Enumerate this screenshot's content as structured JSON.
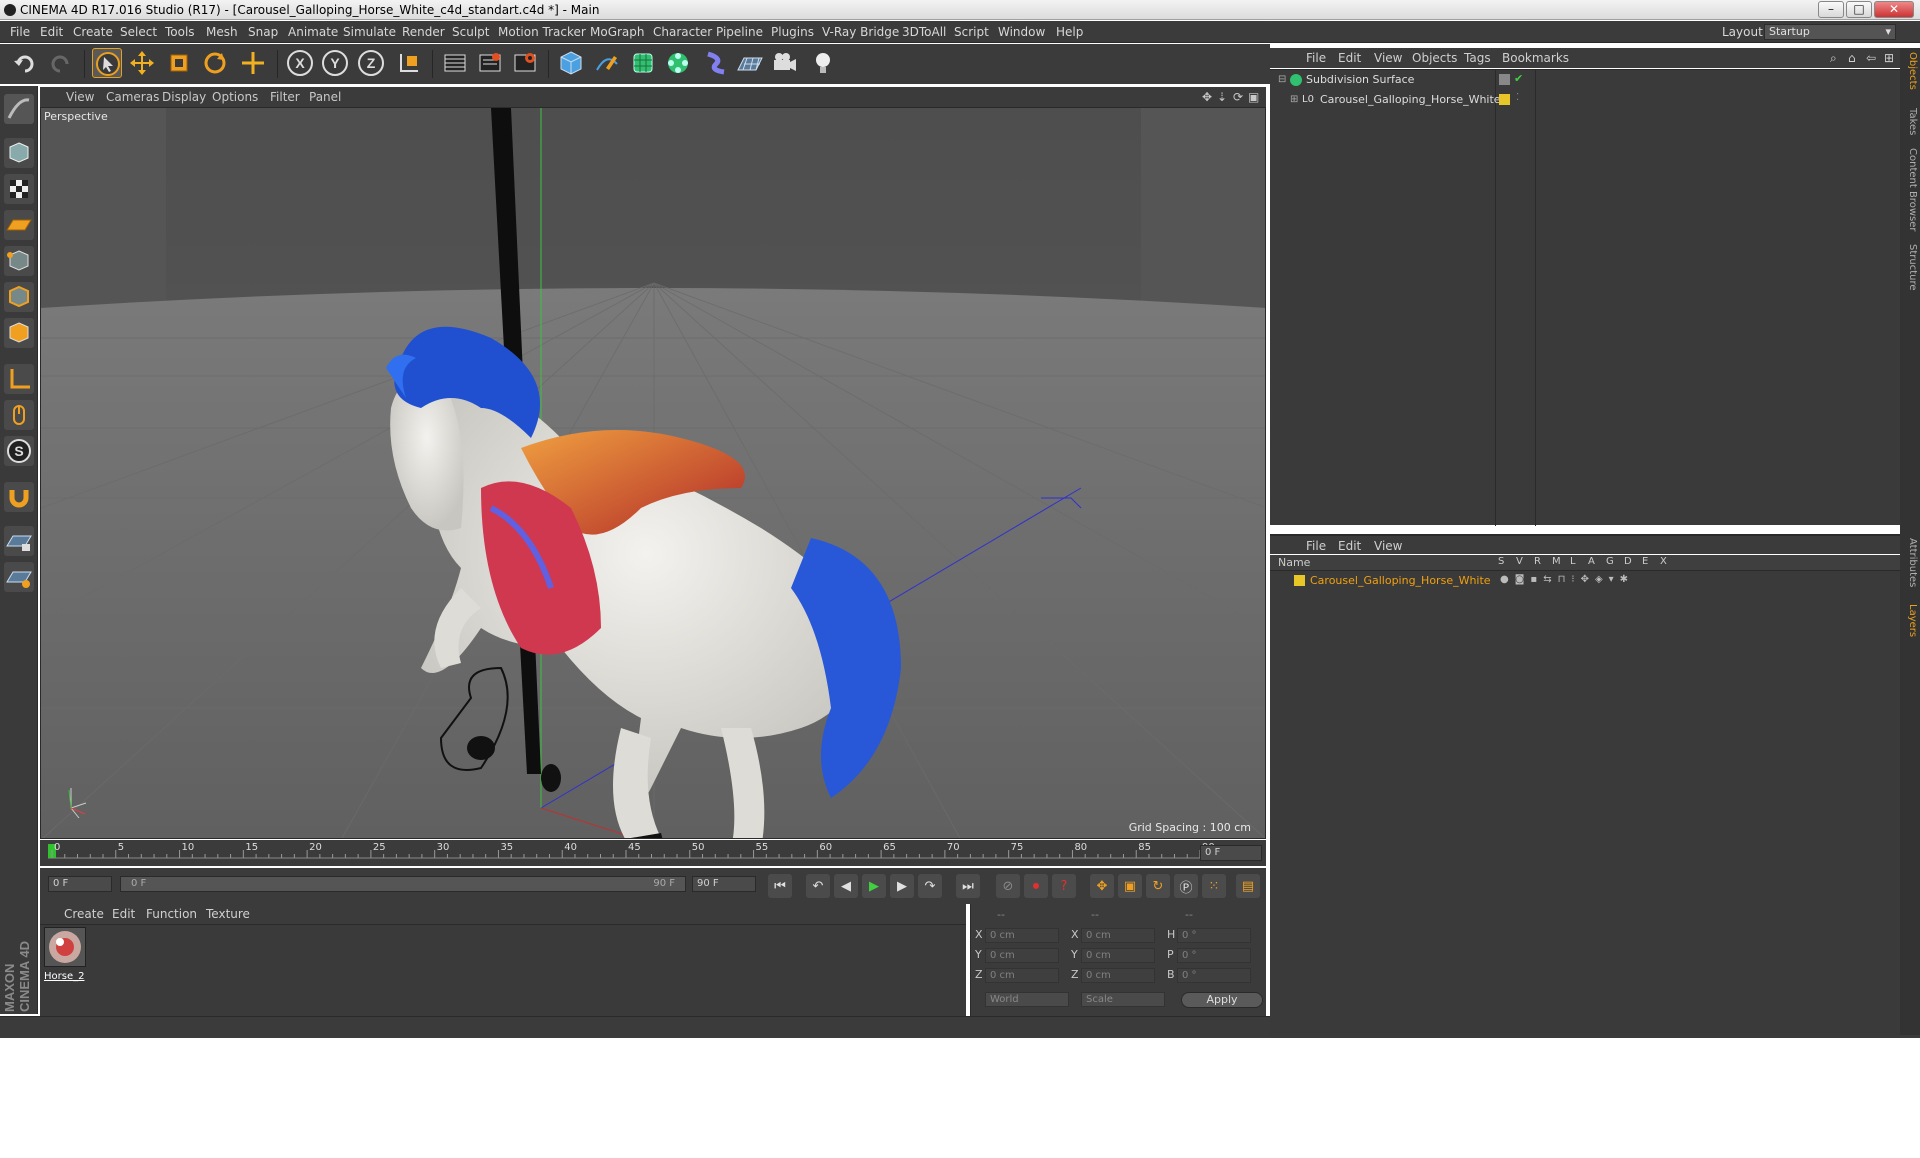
{
  "window": {
    "title": "CINEMA 4D R17.016 Studio (R17) - [Carousel_Galloping_Horse_White_c4d_standart.c4d *] - Main",
    "minimize": "–",
    "maximize": "□",
    "close": "✕"
  },
  "menubar": {
    "items": [
      "File",
      "Edit",
      "Create",
      "Select",
      "Tools",
      "Mesh",
      "Snap",
      "Animate",
      "Simulate",
      "Render",
      "Sculpt",
      "Motion Tracker",
      "MoGraph",
      "Character",
      "Pipeline",
      "Plugins",
      "V-Ray Bridge",
      "3DToAll",
      "Script",
      "Window",
      "Help"
    ],
    "layout_label": "Layout:",
    "layout_value": "Startup"
  },
  "toolbar": {
    "icons": [
      "undo-icon",
      "redo-icon",
      "select-arrow-icon",
      "move-icon",
      "scale-icon",
      "rotate-icon",
      "transform-icon",
      "x-axis-icon",
      "y-axis-icon",
      "z-axis-icon",
      "coordinate-system-icon",
      "render-view-icon",
      "render-picture-viewer-icon",
      "render-settings-icon",
      "cube-icon",
      "pen-icon",
      "subdivision-icon",
      "cloner-icon",
      "deformer-icon",
      "floor-icon",
      "camera-icon",
      "light-icon"
    ],
    "axis_labels": [
      "X",
      "Y",
      "Z"
    ]
  },
  "viewport": {
    "menu": [
      "View",
      "Cameras",
      "Display",
      "Options",
      "Filter",
      "Panel"
    ],
    "camera_label": "Perspective",
    "grid_spacing": "Grid Spacing : 100 cm"
  },
  "timeline": {
    "ticks": [
      "0",
      "5",
      "10",
      "15",
      "20",
      "25",
      "30",
      "35",
      "40",
      "45",
      "50",
      "55",
      "60",
      "65",
      "70",
      "75",
      "80",
      "85",
      "90"
    ],
    "current_frame": "0 F",
    "start_field": "0 F",
    "range_start": "0 F",
    "range_end": "90 F",
    "end_field": "90 F"
  },
  "materials": {
    "menu": [
      "Create",
      "Edit",
      "Function",
      "Texture"
    ],
    "items": [
      {
        "name": "Horse_2"
      }
    ]
  },
  "coordinates": {
    "header": [
      "--",
      "--",
      "--"
    ],
    "rows": [
      {
        "a": "X",
        "av": "0 cm",
        "b": "X",
        "bv": "0 cm",
        "c": "H",
        "cv": "0 °"
      },
      {
        "a": "Y",
        "av": "0 cm",
        "b": "Y",
        "bv": "0 cm",
        "c": "P",
        "cv": "0 °"
      },
      {
        "a": "Z",
        "av": "0 cm",
        "b": "Z",
        "bv": "0 cm",
        "c": "B",
        "cv": "0 °"
      }
    ],
    "mode": "World",
    "scale": "Scale",
    "apply": "Apply"
  },
  "object_manager": {
    "menu": [
      "File",
      "Edit",
      "View",
      "Objects",
      "Tags",
      "Bookmarks"
    ],
    "objects": [
      {
        "name": "Subdivision Surface",
        "icon": "subdivision-surface-icon"
      },
      {
        "name": "Carousel_Galloping_Horse_White",
        "icon": "null-object-icon"
      }
    ]
  },
  "layer_manager": {
    "menu": [
      "File",
      "Edit",
      "View"
    ],
    "columns": [
      "Name",
      "S",
      "V",
      "R",
      "M",
      "L",
      "A",
      "G",
      "D",
      "E",
      "X"
    ],
    "layers": [
      {
        "name": "Carousel_Galloping_Horse_White",
        "color": "#e8c628"
      }
    ]
  },
  "right_tabs": [
    "Objects",
    "Takes",
    "Content Browser",
    "Structure",
    "Attributes",
    "Layers"
  ],
  "brand": "MAXON CINEMA 4D",
  "colors": {
    "accent": "#e8c628",
    "active_layer_text": "#f0a010",
    "play_green": "#40d040",
    "record_red": "#e03030"
  }
}
